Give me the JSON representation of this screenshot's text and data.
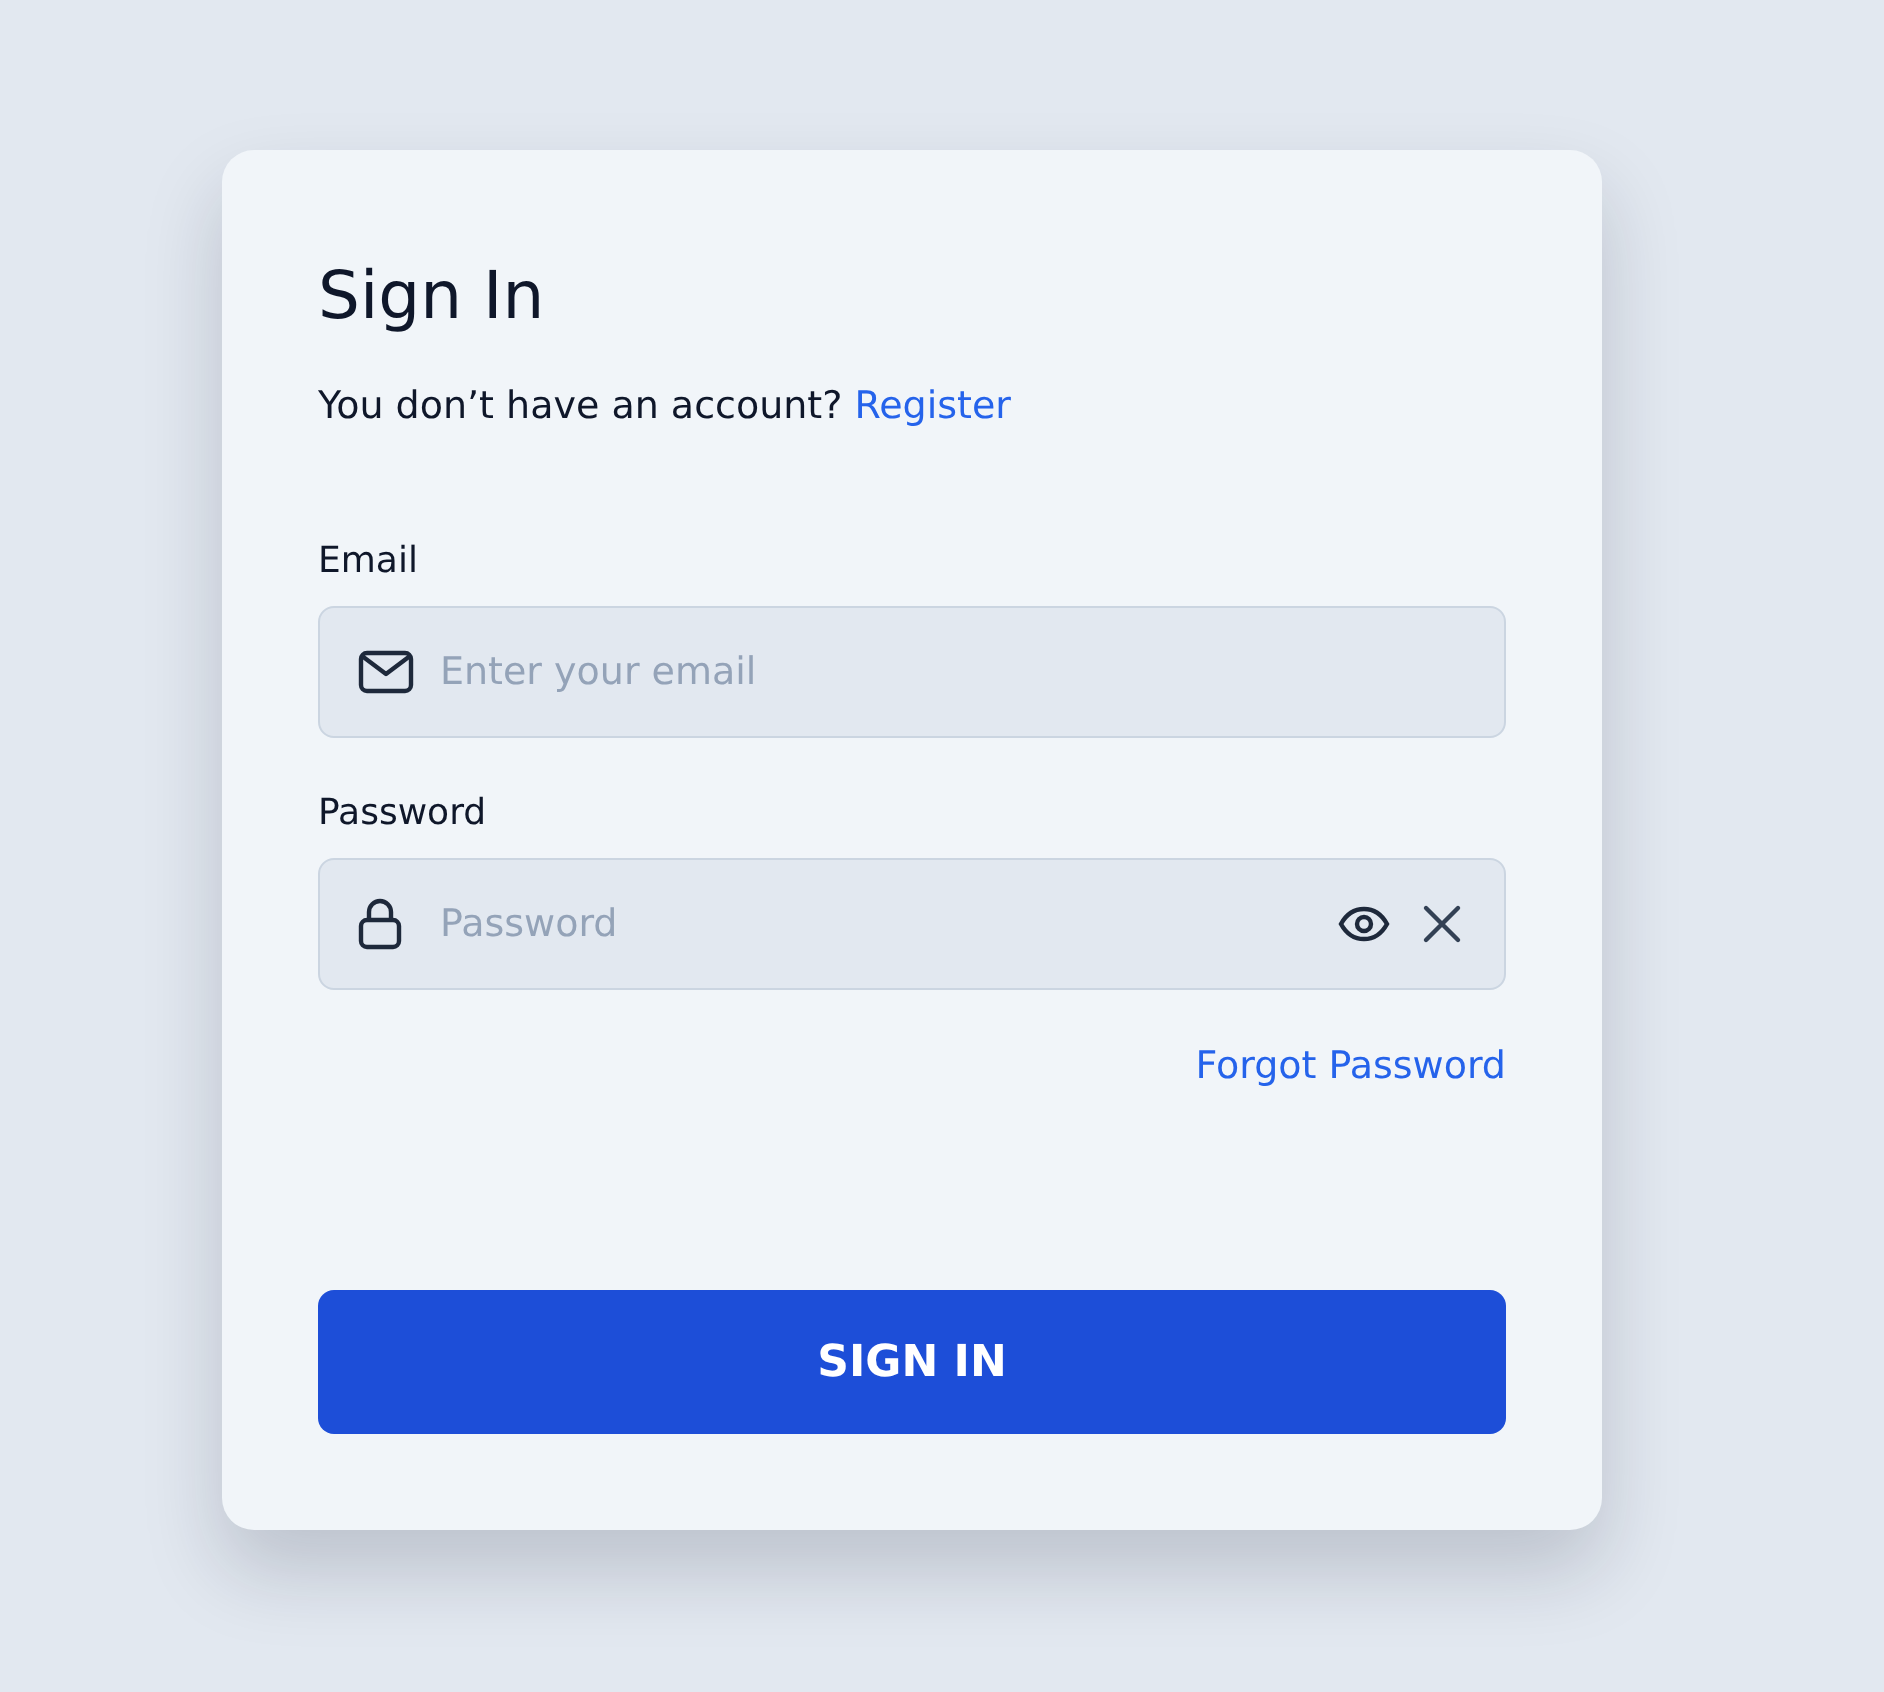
{
  "title": "Sign In",
  "prompt": {
    "text": "You don’t have an account?",
    "link": "Register"
  },
  "fields": [
    {
      "kind": "email",
      "label": "Email",
      "placeholder": "Enter your email"
    },
    {
      "kind": "password",
      "label": "Password",
      "placeholder": "Password"
    }
  ],
  "forgot_link": "Forgot Password",
  "submit_button": "SIGN IN"
}
